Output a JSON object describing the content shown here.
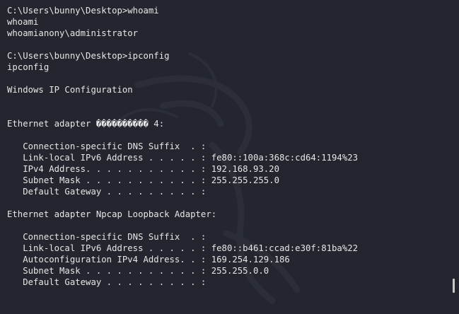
{
  "colors": {
    "background": "#23262e",
    "text": "#e6e6e6",
    "logo": "#2d3039"
  },
  "background_icon": "kali-dragon-logo",
  "terminal": {
    "lines": [
      "C:\\Users\\bunny\\Desktop>whoami",
      "whoami",
      "whoamianony\\administrator",
      "",
      "C:\\Users\\bunny\\Desktop>ipconfig",
      "ipconfig",
      "",
      "Windows IP Configuration",
      "",
      "",
      "Ethernet adapter ���������� 4:",
      "",
      "   Connection-specific DNS Suffix  . :",
      "   Link-local IPv6 Address . . . . . : fe80::100a:368c:cd64:1194%23",
      "   IPv4 Address. . . . . . . . . . . : 192.168.93.20",
      "   Subnet Mask . . . . . . . . . . . : 255.255.255.0",
      "   Default Gateway . . . . . . . . . :",
      "",
      "Ethernet adapter Npcap Loopback Adapter:",
      "",
      "   Connection-specific DNS Suffix  . :",
      "   Link-local IPv6 Address . . . . . : fe80::b461:ccad:e30f:81ba%22",
      "   Autoconfiguration IPv4 Address. . : 169.254.129.186",
      "   Subnet Mask . . . . . . . . . . . : 255.255.0.0",
      "   Default Gateway . . . . . . . . . :"
    ]
  }
}
